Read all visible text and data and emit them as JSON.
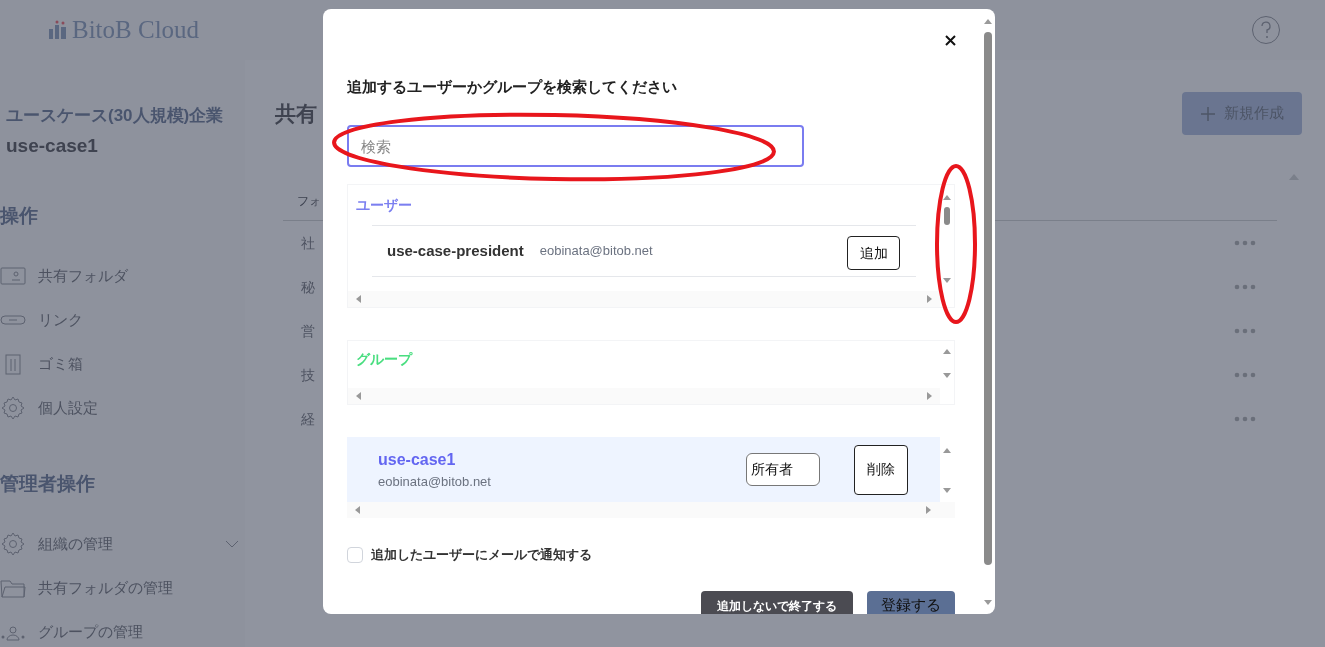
{
  "app": {
    "logo": "BitoB Cloud"
  },
  "sidebar": {
    "org_name": "ユースケース(30人規模)企業",
    "user": "use-case1",
    "sections": [
      {
        "title": "操作",
        "items": [
          {
            "label": "共有フォルダ",
            "kind": "shared-folder",
            "has_submenu": false
          },
          {
            "label": "リンク",
            "kind": "link",
            "has_submenu": false
          },
          {
            "label": "ゴミ箱",
            "kind": "trash",
            "has_submenu": false
          },
          {
            "label": "個人設定",
            "kind": "settings",
            "has_submenu": false
          }
        ]
      },
      {
        "title": "管理者操作",
        "items": [
          {
            "label": "組織の管理",
            "kind": "settings",
            "has_submenu": true
          },
          {
            "label": "共有フォルダの管理",
            "kind": "folder",
            "has_submenu": false
          },
          {
            "label": "グループの管理",
            "kind": "group",
            "has_submenu": false
          }
        ]
      }
    ]
  },
  "main": {
    "title": "共有",
    "new_button": "新規作成",
    "table": {
      "columns": [
        "フォ"
      ],
      "rows": [
        {
          "name": "社"
        },
        {
          "name": "秘"
        },
        {
          "name": "営"
        },
        {
          "name": "技"
        },
        {
          "name": "経"
        }
      ]
    }
  },
  "modal": {
    "title": "追加するユーザーかグループを検索してください",
    "search": {
      "placeholder": "検索"
    },
    "users": {
      "heading": "ユーザー",
      "rows": [
        {
          "name": "use-case-president",
          "email": "eobinata@bitob.net",
          "button": "追加"
        }
      ]
    },
    "groups": {
      "heading": "グループ"
    },
    "members": [
      {
        "name": "use-case1",
        "email": "eobinata@bitob.net",
        "role": "所有者",
        "button": "削除",
        "selected": true
      }
    ],
    "notify": {
      "label": "追加したユーザーにメールで通知する",
      "checked": false
    },
    "buttons": [
      {
        "label": "追加しないで終了する",
        "kind": "secondary"
      },
      {
        "label": "登録する",
        "kind": "primary"
      }
    ]
  }
}
